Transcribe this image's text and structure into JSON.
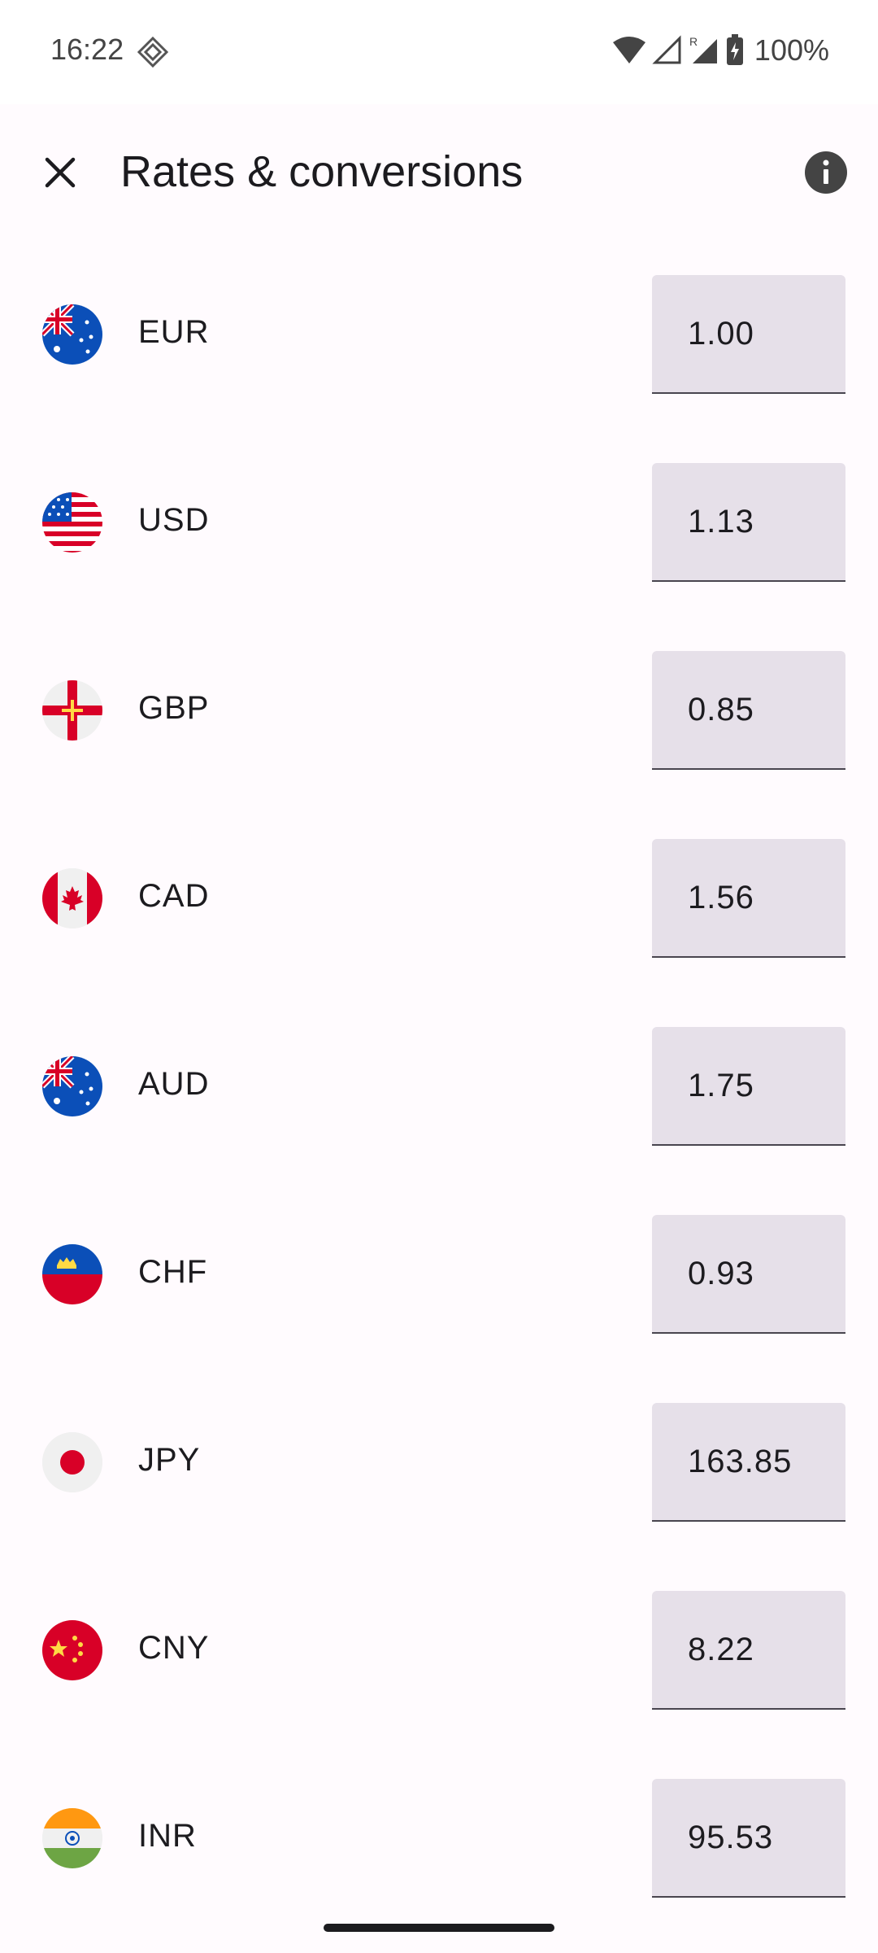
{
  "status_bar": {
    "time": "16:22",
    "battery": "100%"
  },
  "app_bar": {
    "title": "Rates & conversions",
    "close_icon": "close-icon",
    "info_icon": "info-icon"
  },
  "currencies": [
    {
      "code": "EUR",
      "rate": "1.00",
      "flag": "australia-flag-icon"
    },
    {
      "code": "USD",
      "rate": "1.13",
      "flag": "usa-flag-icon"
    },
    {
      "code": "GBP",
      "rate": "0.85",
      "flag": "guernsey-flag-icon"
    },
    {
      "code": "CAD",
      "rate": "1.56",
      "flag": "canada-flag-icon"
    },
    {
      "code": "AUD",
      "rate": "1.75",
      "flag": "australia-flag-icon"
    },
    {
      "code": "CHF",
      "rate": "0.93",
      "flag": "liechtenstein-flag-icon"
    },
    {
      "code": "JPY",
      "rate": "163.85",
      "flag": "japan-flag-icon"
    },
    {
      "code": "CNY",
      "rate": "8.22",
      "flag": "china-flag-icon"
    },
    {
      "code": "INR",
      "rate": "95.53",
      "flag": "india-flag-icon"
    }
  ]
}
